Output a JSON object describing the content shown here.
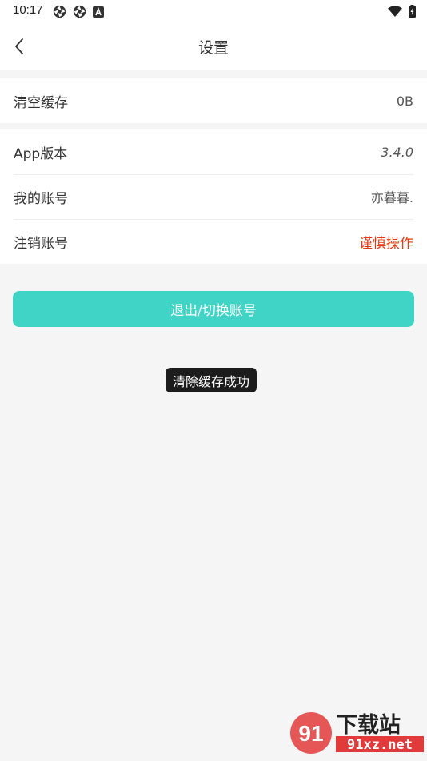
{
  "status_bar": {
    "time": "10:17"
  },
  "header": {
    "title": "设置"
  },
  "cache_section": {
    "label": "清空缓存",
    "value": "0B"
  },
  "info_section": {
    "rows": [
      {
        "label": "App版本",
        "value": "3.4.0"
      },
      {
        "label": "我的账号",
        "value": "亦暮暮."
      },
      {
        "label": "注销账号",
        "value": "谨慎操作"
      }
    ]
  },
  "logout_button": {
    "label": "退出/切换账号"
  },
  "toast": {
    "message": "清除缓存成功"
  },
  "watermark": {
    "logo_text": "91",
    "brand": "下载站",
    "domain": "91xz.net"
  },
  "colors": {
    "accent": "#3fd4c5",
    "danger": "#e8380d",
    "background": "#f5f5f5",
    "watermark_red": "#e23a3a"
  },
  "icons": {
    "back": "chevron-left-icon",
    "status_app1": "aperture-icon",
    "status_app2": "aperture-icon",
    "status_app3": "a-box-icon",
    "wifi": "wifi-icon",
    "battery": "battery-charging-icon"
  }
}
